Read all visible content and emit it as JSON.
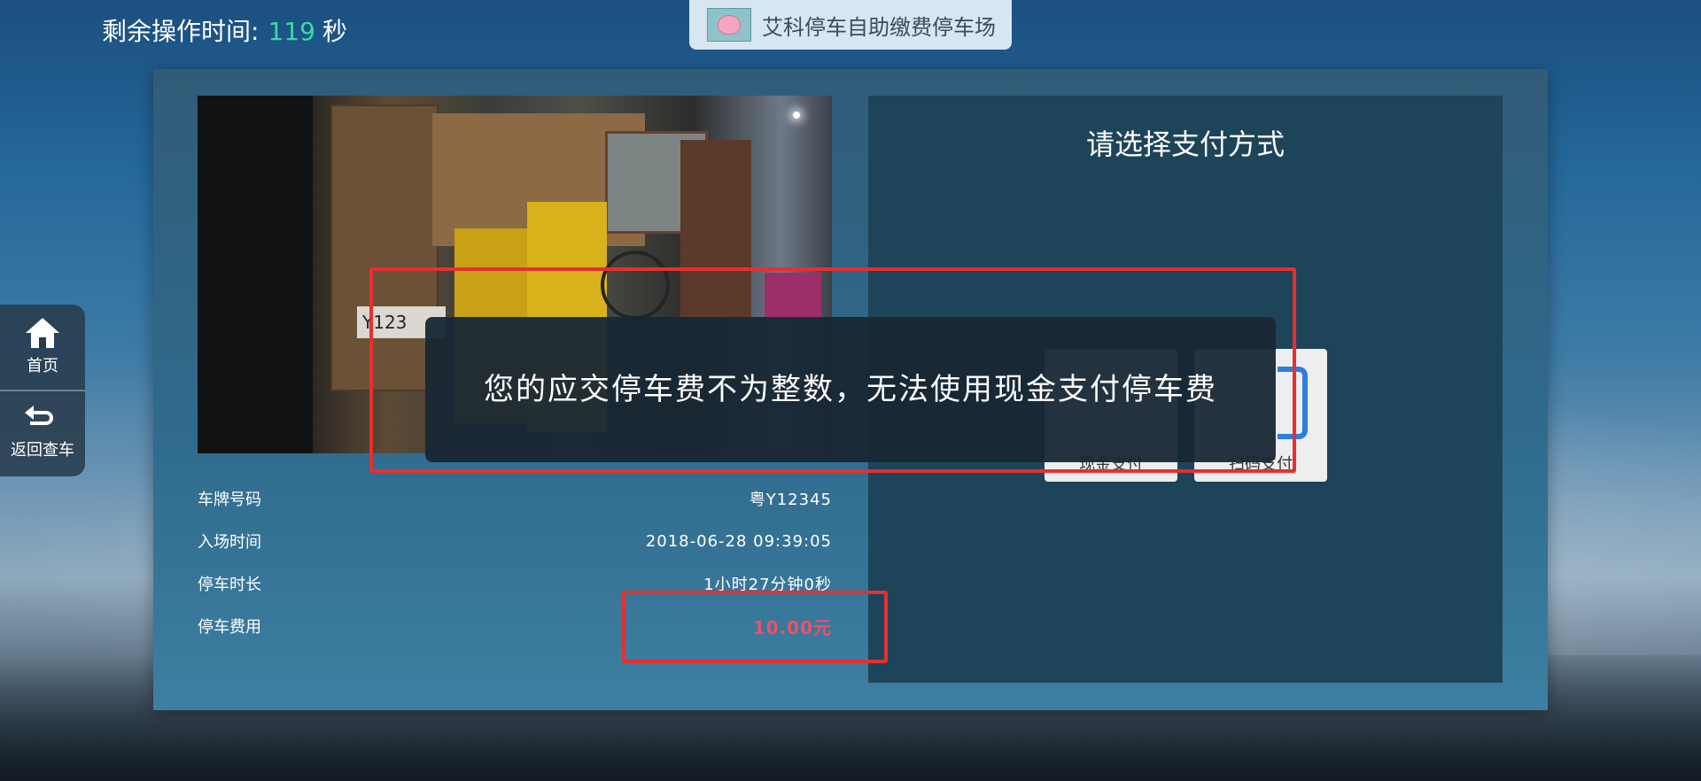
{
  "countdown": {
    "label": "剩余操作时间:",
    "seconds": "119",
    "unit": "秒"
  },
  "header": {
    "lot_name": "艾科停车自助缴费停车场"
  },
  "side_nav": {
    "home_label": "首页",
    "back_label": "返回查车"
  },
  "camera": {
    "plate_visible_text": "Y123"
  },
  "vehicle_info": [
    {
      "label": "车牌号码",
      "value": "粤Y12345"
    },
    {
      "label": "入场时间",
      "value": "2018-06-28 09:39:05"
    },
    {
      "label": "停车时长",
      "value": "1小时27分钟0秒"
    },
    {
      "label": "停车费用",
      "value": "10.00元"
    }
  ],
  "payment": {
    "title": "请选择支付方式",
    "cash_label": "现金支付",
    "scan_label": "扫码支付"
  },
  "toast": {
    "message": "您的应交停车费不为整数，无法使用现金支付停车费"
  },
  "colors": {
    "countdown_accent": "#39d9a6",
    "fee_text": "#f05068",
    "annotation_red": "#e53030",
    "scan_icon_blue": "#2f7de0"
  }
}
